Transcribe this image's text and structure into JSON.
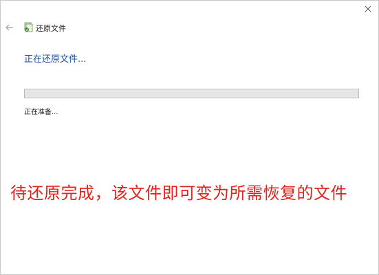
{
  "window": {
    "title": "还原文件",
    "heading": "正在还原文件...",
    "status_text": "正在准备...",
    "progress": 0
  },
  "overlay": {
    "caption": "待还原完成，该文件即可变为所需恢复的文件"
  },
  "icons": {
    "back": "back-arrow-icon",
    "close": "close-icon",
    "app": "file-history-icon"
  },
  "colors": {
    "heading": "#1e4fa0",
    "caption": "#e0231c",
    "progress_track": "#e6e6e6"
  }
}
